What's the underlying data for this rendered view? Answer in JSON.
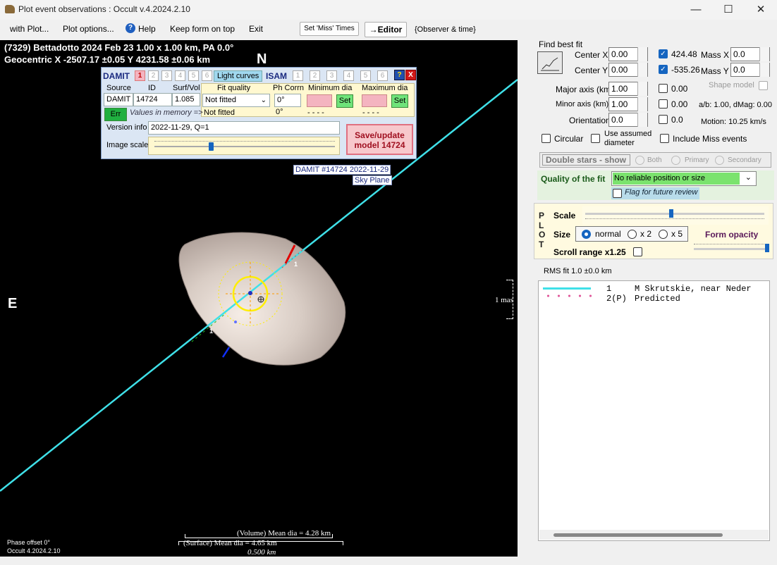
{
  "window": {
    "title": "Plot event observations : Occult v.4.2024.2.10",
    "controls": {
      "minimize": "—",
      "maximize": "☐",
      "close": "✕"
    }
  },
  "menu": {
    "items": [
      "with Plot...",
      "Plot options...",
      "Help",
      "Keep form on top",
      "Exit"
    ],
    "set_miss_times": "Set 'Miss' Times",
    "editor": "→Editor",
    "observer_time": "{Observer & time}"
  },
  "plot": {
    "header_line1": "(7329) Bettadotto  2024 Feb 23   1.00 x 1.00 km,  PA 0.0°",
    "header_line2": "Geocentric  X  -2507.17 ±0.05  Y 4231.58 ±0.06 km",
    "north": "N",
    "east": "E",
    "damit_label": "DAMIT #14724 2022-11-29",
    "sky_plane": "Sky Plane",
    "chord_number": "1",
    "scale_mas": "1 mas",
    "volume_dia": "(Volume) Mean dia = 4.28 km",
    "surface_dia": "(Surface) Mean dia = 4.65 km",
    "scale_km": "0.500 km",
    "phase_offset": "Phase offset 0°",
    "version": "Occult 4.2024.2.10"
  },
  "damit_panel": {
    "damit_title": "DAMIT",
    "damit_models": [
      "1",
      "2",
      "3",
      "4",
      "5",
      "6"
    ],
    "light_curves": "Light curves",
    "isam_title": "ISAM",
    "isam_models": [
      "1",
      "2",
      "3",
      "4",
      "5",
      "6"
    ],
    "help": "?",
    "close": "X",
    "col_source": "Source",
    "col_id": "ID",
    "col_surfvol": "Surf/Vol",
    "col_fit_quality": "Fit quality",
    "col_ph_corrn": "Ph Corrn",
    "col_min_dia": "Minimum dia",
    "col_max_dia": "Maximum dia",
    "source": "DAMIT",
    "id": "14724",
    "surfvol": "1.085",
    "fit_quality_selected": "Not fitted",
    "fit_quality_memory": "Not fitted",
    "ph_corrn_1": "0°",
    "ph_corrn_2": "0°",
    "min_dash": "- - - -",
    "max_dash": "- - - -",
    "set": "Set",
    "err": "Err",
    "values_in_memory": "Values in memory =>",
    "version_info_label": "Version info",
    "version_info": "2022-11-29, Q=1",
    "image_scale_label": "Image scale",
    "image_scale_value": 0.3,
    "save_update": "Save/update\nmodel  14724"
  },
  "fit_panel": {
    "find_best_fit": "Find best fit",
    "center_x_label": "Center X",
    "center_x": "0.00",
    "center_y_label": "Center Y",
    "center_y": "0.00",
    "center_x_checked": true,
    "center_x_value": "424.48",
    "center_y_checked": true,
    "center_y_value": "-535.26",
    "mass_x_label": "Mass X",
    "mass_x": "0.0",
    "mass_y_label": "Mass Y",
    "mass_y": "0.0",
    "major_axis_label": "Major axis (km)",
    "major_axis": "1.00",
    "major_axis_fit": "0.00",
    "shape_model": "Shape model",
    "minor_axis_label": "Minor axis (km)",
    "minor_axis": "1.00",
    "minor_axis_fit": "0.00",
    "ab_dmag": "a/b: 1.00, dMag: 0.00",
    "orientation_label": "Orientation",
    "orientation": "0.0",
    "orientation_fit": "0.0",
    "motion": "Motion: 10.25 km/s",
    "circular": "Circular",
    "use_assumed_diameter": "Use assumed\ndiameter",
    "include_miss_events": "Include Miss events",
    "double_stars_show": "Double stars - show",
    "both": "Both",
    "primary": "Primary",
    "secondary": "Secondary",
    "quality_label": "Quality of the fit",
    "quality_value": "No reliable position or size",
    "flag_review": "Flag for future review"
  },
  "plot_panel": {
    "plot_letters": [
      "P",
      "L",
      "O",
      "T"
    ],
    "scale_label": "Scale",
    "scale_value": 0.47,
    "size_label": "Size",
    "size_normal": "normal",
    "size_x2": "x 2",
    "size_x5": "x 5",
    "form_opacity": "Form opacity",
    "opacity_value": 0.97,
    "scroll_range": "Scroll range x1.25"
  },
  "legend": {
    "rms_fit": "RMS fit 1.0 ±0.0 km",
    "rows": [
      {
        "num": "1",
        "name": "M Skrutskie, near Neder"
      },
      {
        "num": "2(P)",
        "name": "Predicted"
      }
    ]
  },
  "colors": {
    "chord": "#3fe0e8",
    "predicted": "#e0589a",
    "accent": "#1565c0",
    "quality_bg": "#7be36e"
  }
}
